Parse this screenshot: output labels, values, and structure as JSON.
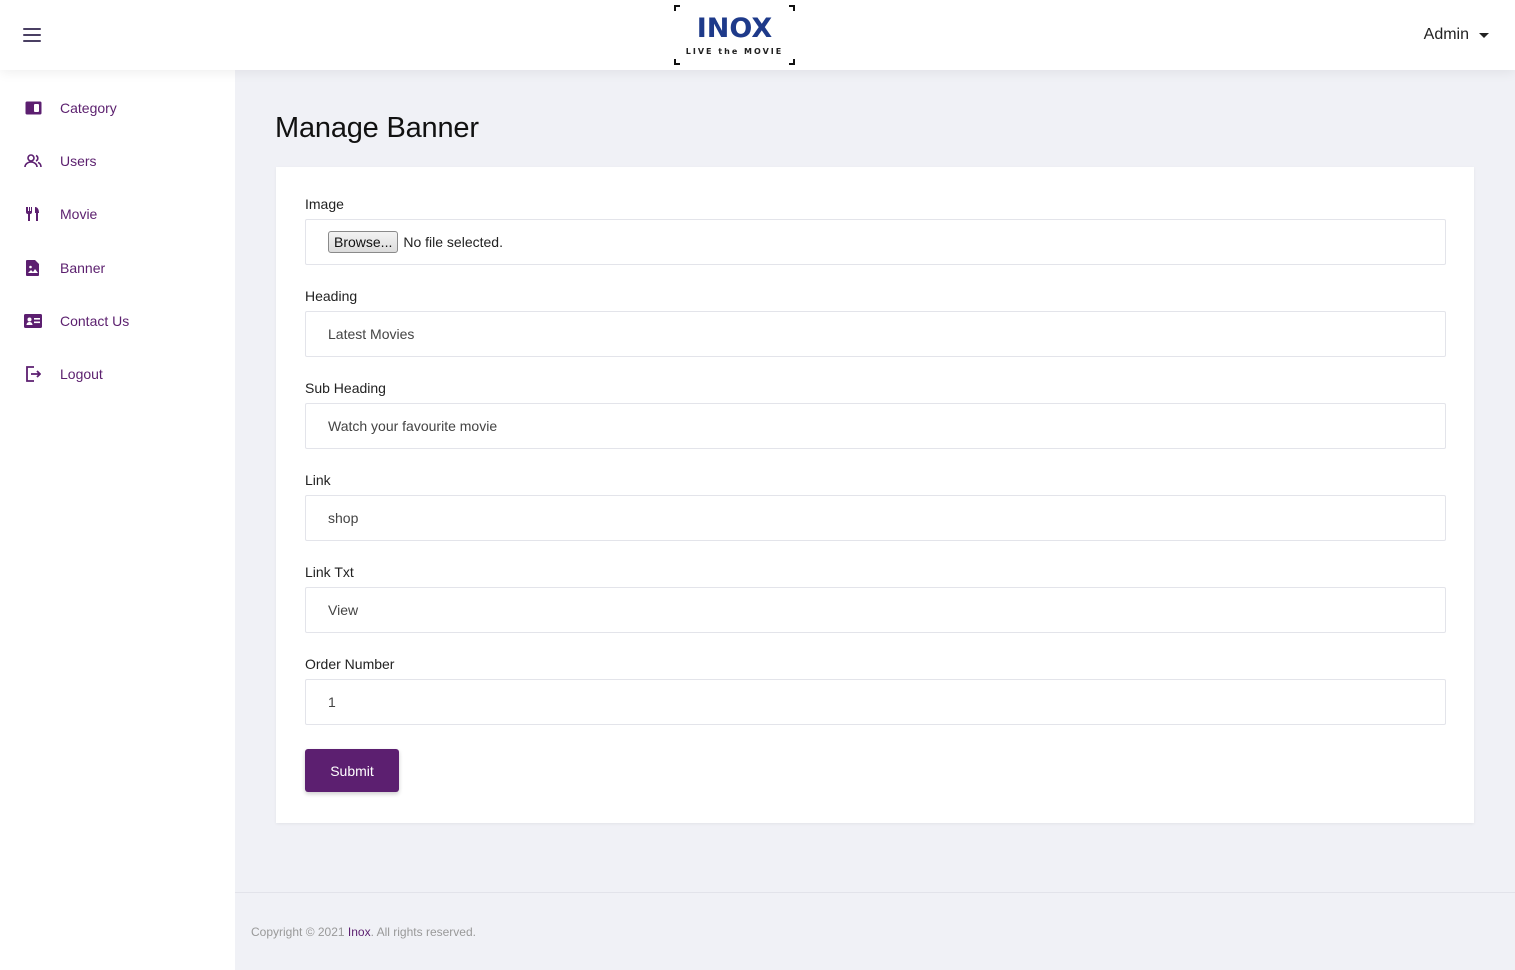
{
  "header": {
    "logo_brand": "INOX",
    "logo_tagline": "LIVE the MOVIE",
    "user_label": "Admin"
  },
  "sidebar": {
    "items": [
      {
        "label": "Category",
        "icon": "category-card-icon"
      },
      {
        "label": "Users",
        "icon": "users-icon"
      },
      {
        "label": "Movie",
        "icon": "cutlery-icon"
      },
      {
        "label": "Banner",
        "icon": "image-file-icon"
      },
      {
        "label": "Contact Us",
        "icon": "contact-card-icon"
      },
      {
        "label": "Logout",
        "icon": "logout-icon"
      }
    ]
  },
  "main": {
    "title": "Manage Banner",
    "form": {
      "image_label": "Image",
      "browse_label": "Browse...",
      "file_status": "No file selected.",
      "heading_label": "Heading",
      "heading_value": "Latest Movies",
      "subheading_label": "Sub Heading",
      "subheading_value": "Watch your favourite movie",
      "link_label": "Link",
      "link_value": "shop",
      "linktxt_label": "Link Txt",
      "linktxt_value": "View",
      "order_label": "Order Number",
      "order_value": "1",
      "submit_label": "Submit"
    }
  },
  "footer": {
    "prefix": "Copyright © 2021 ",
    "brand": "Inox",
    "suffix": ". All rights reserved."
  },
  "colors": {
    "accent": "#5c1f70",
    "logo_blue": "#1e3a8a",
    "background": "#f0f1f6"
  }
}
